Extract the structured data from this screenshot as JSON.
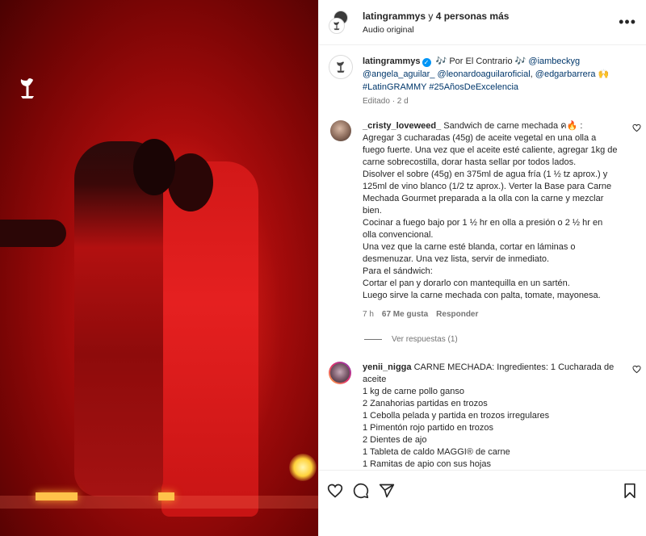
{
  "header": {
    "account": "latingrammys",
    "joiner": " y ",
    "others": "4 personas más",
    "audio": "Audio original",
    "more": "•••"
  },
  "caption": {
    "username": "latingrammys",
    "segments": [
      {
        "text": " 🎶 Por El Contrario 🎶 ",
        "link": false
      },
      {
        "text": "@iambeckyg",
        "link": true
      },
      {
        "text": " ",
        "link": false
      },
      {
        "text": "@angela_aguilar_",
        "link": true
      },
      {
        "text": " ",
        "link": false
      },
      {
        "text": "@leonardoaguilaroficial",
        "link": true
      },
      {
        "text": ", ",
        "link": false
      },
      {
        "text": "@edgarbarrera",
        "link": true
      },
      {
        "text": " 🙌 ",
        "link": false
      },
      {
        "text": "#LatinGRAMMY",
        "link": true
      },
      {
        "text": " ",
        "link": false
      },
      {
        "text": "#25AñosDeExcelencia",
        "link": true
      }
    ],
    "meta": "Editado · 2 d"
  },
  "comments": [
    {
      "username": "_cristy_loveweed_",
      "lines": [
        "Sandwich de carne mechada ค🔥 :",
        "Agregar 3 cucharadas (45g) de aceite vegetal en una olla a fuego fuerte. Una vez que el aceite esté caliente, agregar 1kg de carne sobrecostilla, dorar hasta sellar por todos lados.",
        "Disolver el sobre (45g) en 375ml de agua fría (1 ½ tz aprox.) y 125ml de vino blanco (1/2 tz aprox.). Verter la Base para Carne Mechada Gourmet preparada a la olla con la carne y mezclar bien.",
        "Cocinar a fuego bajo por 1 ½ hr en olla a presión o 2 ½ hr en olla convencional.",
        "Una vez que la carne esté blanda, cortar en láminas o desmenuzar. Una vez lista, servir de inmediato.",
        "Para el sándwich:",
        "Cortar el pan y dorarlo con mantequilla en un sartén.",
        "Luego sirve la carne mechada con palta, tomate, mayonesa."
      ],
      "time": "7 h",
      "likes": "67 Me gusta",
      "reply": "Responder",
      "view_replies": "Ver respuestas (1)"
    },
    {
      "username": "yenii_nigga",
      "lines": [
        "CARNE MECHADA: Ingredientes: 1 Cucharada de aceite",
        "1 kg de carne pollo ganso",
        "2 Zanahorias partidas en trozos",
        "1 Cebolla pelada y partida en trozos irregulares",
        "1 Pimentón rojo partido en trozos",
        "2 Dientes de ajo",
        "1 Tableta de caldo MAGGI® de carne",
        "1 Ramitas de apio con sus hojas"
      ]
    }
  ],
  "colors": {
    "link": "#00376b",
    "verified": "#0095f6",
    "muted": "#737373"
  },
  "icons": [
    "more-icon",
    "verified-icon",
    "heart-icon",
    "comment-icon",
    "share-icon",
    "bookmark-icon",
    "grammy-logo"
  ]
}
